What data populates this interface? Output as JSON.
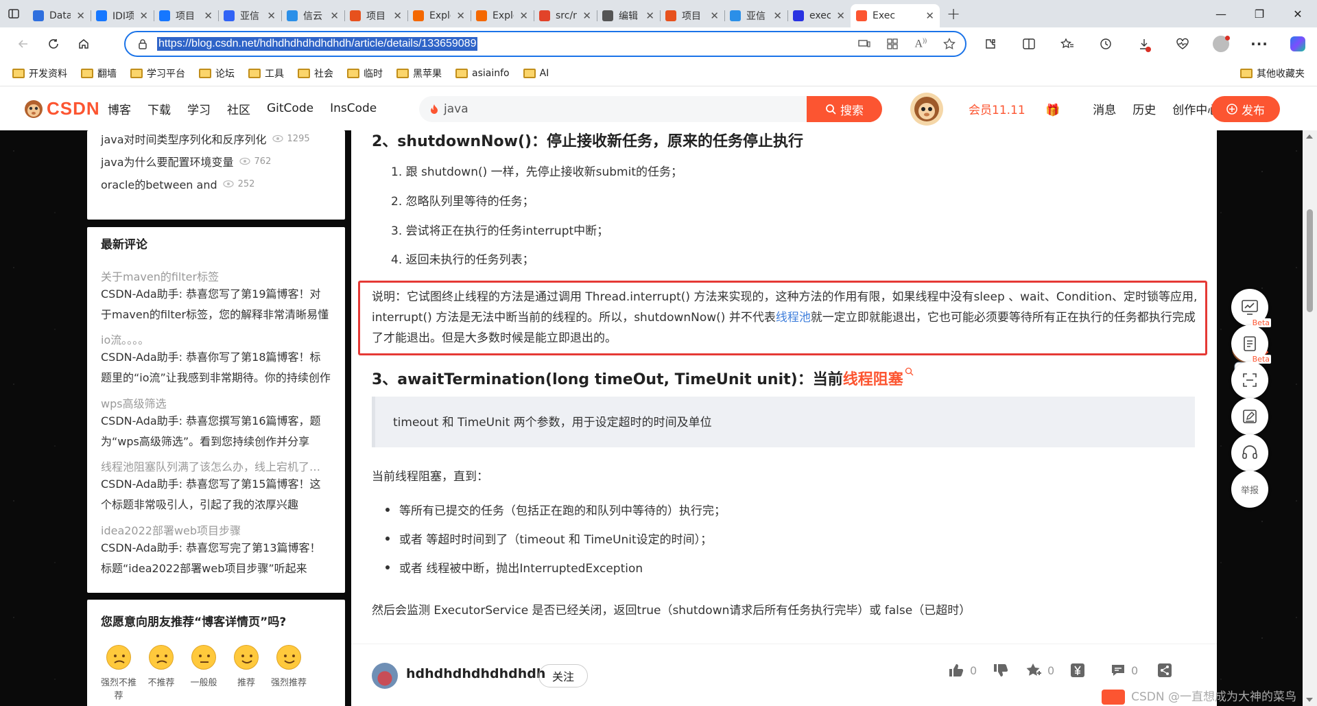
{
  "browser": {
    "tabs": [
      {
        "title": "Data",
        "icon": "infinity-icon",
        "color": "#2f6fde"
      },
      {
        "title": "IDI项",
        "icon": "doc-icon",
        "color": "#1677ff"
      },
      {
        "title": "项目",
        "icon": "doc-icon",
        "color": "#1677ff"
      },
      {
        "title": "亚信",
        "icon": "letter-d-icon",
        "color": "#3163f5"
      },
      {
        "title": "信云",
        "icon": "cube-icon",
        "color": "#2b8fe8"
      },
      {
        "title": "项目",
        "icon": "letter-p-icon",
        "color": "#e7511d"
      },
      {
        "title": "Explo",
        "icon": "grafana-icon",
        "color": "#f46800"
      },
      {
        "title": "Explo",
        "icon": "grafana-icon",
        "color": "#f46800"
      },
      {
        "title": "src/n",
        "icon": "gitlab-icon",
        "color": "#e24329"
      },
      {
        "title": "编辑",
        "icon": "file-icon",
        "color": "#555555"
      },
      {
        "title": "项目",
        "icon": "letter-p-icon",
        "color": "#e7511d"
      },
      {
        "title": "亚信",
        "icon": "cube-icon",
        "color": "#2b8fe8"
      },
      {
        "title": "exec",
        "icon": "paw-icon",
        "color": "#2932e1"
      },
      {
        "title": "Exec",
        "icon": "csdn-c-icon",
        "color": "#fc5531",
        "active": true
      }
    ],
    "url": "https://blog.csdn.net/hdhdhdhdhdhdhdh/article/details/133659089",
    "bookmarks": [
      "开发资料",
      "翻墙",
      "学习平台",
      "论坛",
      "工具",
      "社会",
      "临时",
      "黑苹果",
      "asiainfo",
      "AI"
    ],
    "other_bookmarks": "其他收藏夹"
  },
  "csdn": {
    "logo": "CSDN",
    "nav": [
      "博客",
      "下载",
      "学习",
      "社区",
      "GitCode",
      "InsCode"
    ],
    "search_placeholder": "java",
    "search_button": "搜索",
    "vip": "会员11.11",
    "right_links": [
      "消息",
      "历史",
      "创作中心"
    ],
    "publish": "发布"
  },
  "sidebar": {
    "hot": [
      {
        "title": "java对时间类型序列化和反序列化",
        "views": "1295"
      },
      {
        "title": "java为什么要配置环境变量",
        "views": "762"
      },
      {
        "title": "oracle的between and",
        "views": "252"
      }
    ],
    "comments_title": "最新评论",
    "comments": [
      {
        "title": "关于maven的filter标签",
        "body": "CSDN-Ada助手: 恭喜您写了第19篇博客！对于maven的filter标签，您的解释非常清晰易懂"
      },
      {
        "title": "io流。。。。",
        "body": "CSDN-Ada助手: 恭喜你写了第18篇博客！标题里的“io流”让我感到非常期待。你的持续创作"
      },
      {
        "title": "wps高级筛选",
        "body": "CSDN-Ada助手: 恭喜您撰写第16篇博客，题为“wps高级筛选”。看到您持续创作并分享"
      },
      {
        "title": "线程池阻塞队列满了该怎么办，线上宕机了怎么办",
        "body": "CSDN-Ada助手: 恭喜您写了第15篇博客！这个标题非常吸引人，引起了我的浓厚兴趣"
      },
      {
        "title": "idea2022部署web项目步骤",
        "body": "CSDN-Ada助手: 恭喜您写完了第13篇博客！标题“idea2022部署web项目步骤”听起来"
      }
    ],
    "recommend_title": "您愿意向朋友推荐“博客详情页”吗?",
    "recommend_options": [
      "强烈不推荐",
      "不推荐",
      "一般般",
      "推荐",
      "强烈推荐"
    ]
  },
  "article": {
    "h2_shutdownnow": "2、shutdownNow()：停止接收新任务，原来的任务停止执行",
    "steps": [
      "1. 跟 shutdown() 一样，先停止接收新submit的任务；",
      "2. 忽略队列里等待的任务；",
      "3. 尝试将正在执行的任务interrupt中断；",
      "4. 返回未执行的任务列表；"
    ],
    "note_before_link": "说明：它试图终止线程的方法是通过调用 Thread.interrupt() 方法来实现的，这种方法的作用有限，如果线程中没有sleep 、wait、Condition、定时锁等应用, interrupt() 方法是无法中断当前的线程的。所以，shutdownNow() 并不代表",
    "note_link": "线程池",
    "note_after_link": "就一定立即就能退出，它也可能必须要等待所有正在执行的任务都执行完成了才能退出。但是大多数时候是能立即退出的。",
    "h3_prefix": "3、awaitTermination(long timeOut, TimeUnit unit)：当前",
    "h3_highlight": "线程阻塞",
    "quote": "timeout 和 TimeUnit 两个参数，用于设定超时的时间及单位",
    "blocked_until": "当前线程阻塞，直到：",
    "bullets": [
      "等所有已提交的任务（包括正在跑的和队列中等待的）执行完；",
      "或者 等超时时间到了（timeout 和 TimeUnit设定的时间）；",
      "或者 线程被中断，抛出InterruptedException"
    ],
    "after": "然后会监测 ExecutorService 是否已经关闭，返回true（shutdown请求后所有任务执行完毕）或 false（已超时）",
    "author": "hdhdhdhdhdhdhdh",
    "follow": "关注",
    "like_count": "0",
    "star_count": "0",
    "comment_count": "0"
  },
  "float_toolbar": {
    "beta": "Beta",
    "report": "举报"
  },
  "watermark": "CSDN @一直想成为大神的菜鸟"
}
